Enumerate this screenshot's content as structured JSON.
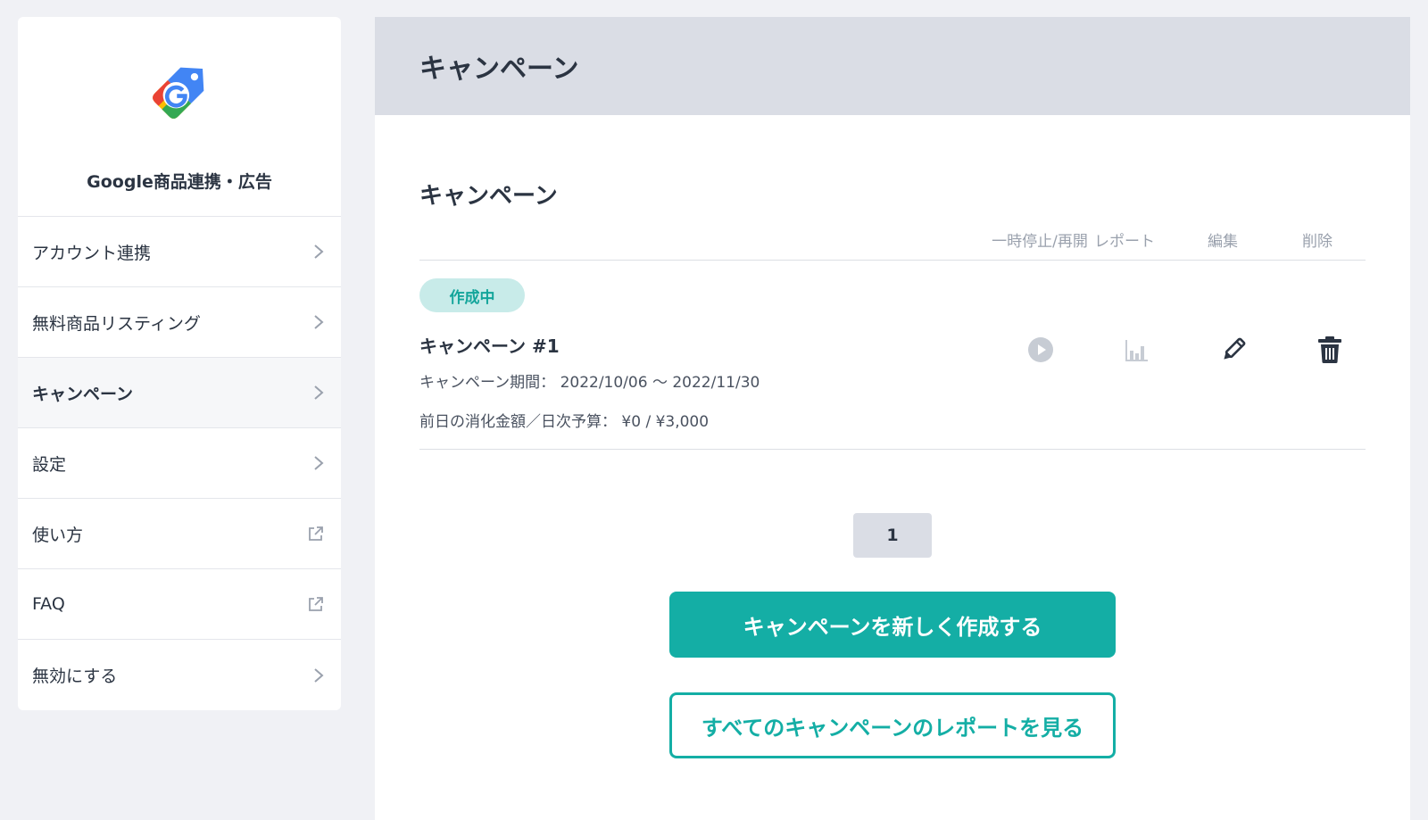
{
  "sidebar": {
    "brand": {
      "name": "Google商品連携・広告"
    },
    "items": [
      {
        "label": "アカウント連携",
        "icon": "chevron-right-icon",
        "active": false
      },
      {
        "label": "無料商品リスティング",
        "icon": "chevron-right-icon",
        "active": false
      },
      {
        "label": "キャンペーン",
        "icon": "chevron-right-icon",
        "active": true
      },
      {
        "label": "設定",
        "icon": "chevron-right-icon",
        "active": false
      },
      {
        "label": "使い方",
        "icon": "external-link-icon",
        "active": false
      },
      {
        "label": "FAQ",
        "icon": "external-link-icon",
        "active": false
      },
      {
        "label": "無効にする",
        "icon": "chevron-right-icon",
        "active": false
      }
    ]
  },
  "header": {
    "title": "キャンペーン"
  },
  "section": {
    "title": "キャンペーン",
    "columns": {
      "pause": "一時停止/再開",
      "report": "レポート",
      "edit": "編集",
      "delete": "削除"
    }
  },
  "campaign": {
    "status": "作成中",
    "name": "キャンペーン #1",
    "period_label": "キャンペーン期間：",
    "period_value": "2022/10/06 〜 2022/11/30",
    "budget_label": "前日の消化金額／日次予算：",
    "budget_value": "¥0 / ¥3,000"
  },
  "pagination": {
    "current": "1"
  },
  "actions": {
    "create_label": "キャンペーンを新しく作成する",
    "report_all_label": "すべてのキャンペーンのレポートを見る"
  },
  "colors": {
    "accent": "#14aea5",
    "badge_bg": "#c8ebe9",
    "header_bg": "#dadde5",
    "page_bg": "#f0f1f5",
    "icon_disabled": "#c7ccd4",
    "icon_active": "#2b3442"
  }
}
